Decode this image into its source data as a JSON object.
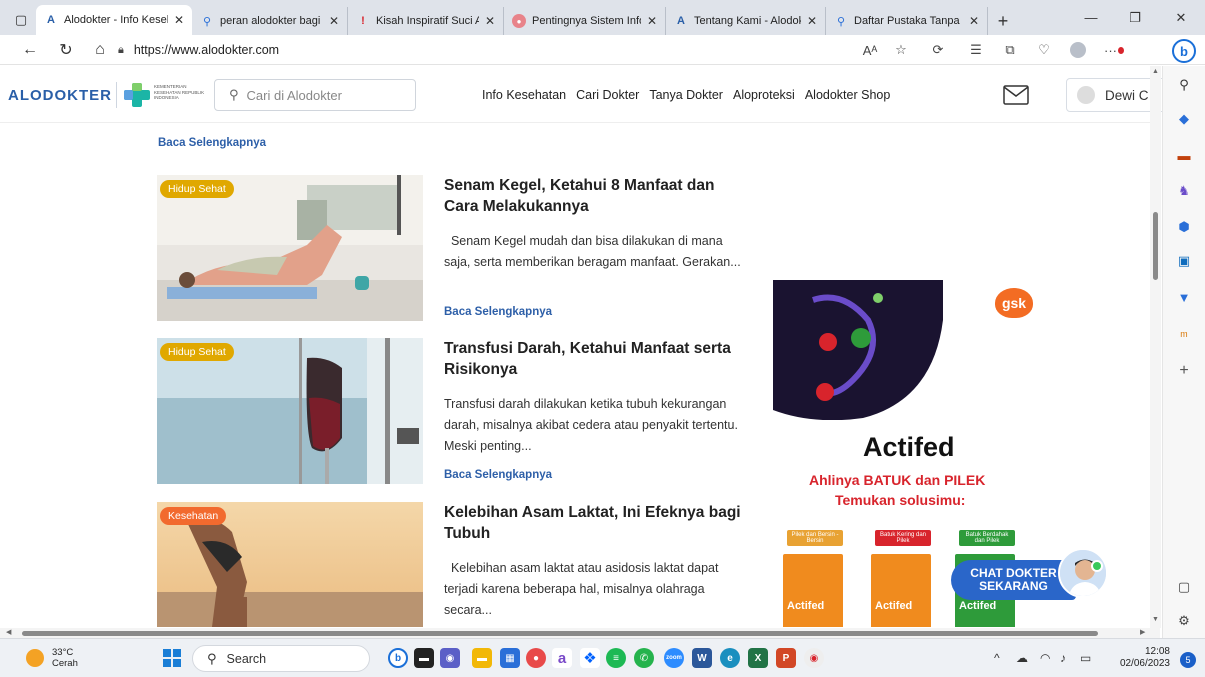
{
  "browser": {
    "tabs": [
      {
        "title": "Alodokter - Info Keseh",
        "icon": "alodokter-icon",
        "active": true
      },
      {
        "title": "peran alodokter bagi n",
        "icon": "search-icon",
        "active": false
      },
      {
        "title": "Kisah Inspiratif Suci Ar",
        "icon": "red-pin-icon",
        "active": false
      },
      {
        "title": "Pentingnya Sistem Info",
        "icon": "red-circle-icon",
        "active": false
      },
      {
        "title": "Tentang Kami - Alodok",
        "icon": "alodokter-icon",
        "active": false
      },
      {
        "title": "Daftar Pustaka Tanpa I",
        "icon": "search-icon",
        "active": false
      }
    ],
    "url": "https://www.alodokter.com",
    "read_aloud_label": "Aᴬ",
    "more_label": "···"
  },
  "site": {
    "logo": "ALODOKTER",
    "kemenkes_text": "KEMENTERIAN KESEHATAN REPUBLIK INDONESIA",
    "search_placeholder": "Cari di Alodokter",
    "nav": [
      "Info Kesehatan",
      "Cari Dokter",
      "Tanya Dokter",
      "Aloproteksi",
      "Alodokter Shop"
    ],
    "user_name": "Dewi C"
  },
  "content": {
    "top_readmore": "Baca Selengkapnya",
    "articles": [
      {
        "badge": "Hidup Sehat",
        "badge_color": "#e0a800",
        "title": "Senam Kegel, Ketahui 8 Manfaat dan Cara Melakukannya",
        "excerpt": "  Senam Kegel mudah dan bisa dilakukan di mana saja, serta memberikan beragam manfaat. Gerakan...",
        "more": "Baca Selengkapnya"
      },
      {
        "badge": "Hidup Sehat",
        "badge_color": "#e0a800",
        "title": "Transfusi Darah, Ketahui Manfaat serta Risikonya",
        "excerpt": "Transfusi darah dilakukan ketika tubuh kekurangan darah, misalnya akibat cedera atau penyakit tertentu. Meski penting...",
        "more": "Baca Selengkapnya"
      },
      {
        "badge": "Kesehatan",
        "badge_color": "#f26a2e",
        "title": "Kelebihan Asam Laktat, Ini Efeknya bagi Tubuh",
        "excerpt": "  Kelebihan asam laktat atau asidosis laktat dapat terjadi karena beberapa hal, misalnya olahraga secara...",
        "more": "Baca Selengkapnya"
      }
    ]
  },
  "ad": {
    "logo": "gsk",
    "brand": "Actifed",
    "tagline1": "Ahlinya BATUK dan PILEK",
    "tagline2": "Temukan solusimu:",
    "products": [
      {
        "label": "Pilek dan Bersin - Bersin",
        "name": "Actifed",
        "color": "#e8a233"
      },
      {
        "label": "Batuk Kering dan Pilek",
        "name": "Actifed",
        "color": "#d8242c"
      },
      {
        "label": "Batuk Berdahak dan Pilek",
        "name": "Actifed",
        "color": "#2e9b3a"
      }
    ]
  },
  "chat": {
    "line1": "CHAT DOKTER",
    "line2": "SEKARANG"
  },
  "taskbar": {
    "temp": "33°C",
    "condition": "Cerah",
    "search": "Search",
    "time": "12:08",
    "date": "02/06/2023",
    "notifications": "5"
  }
}
